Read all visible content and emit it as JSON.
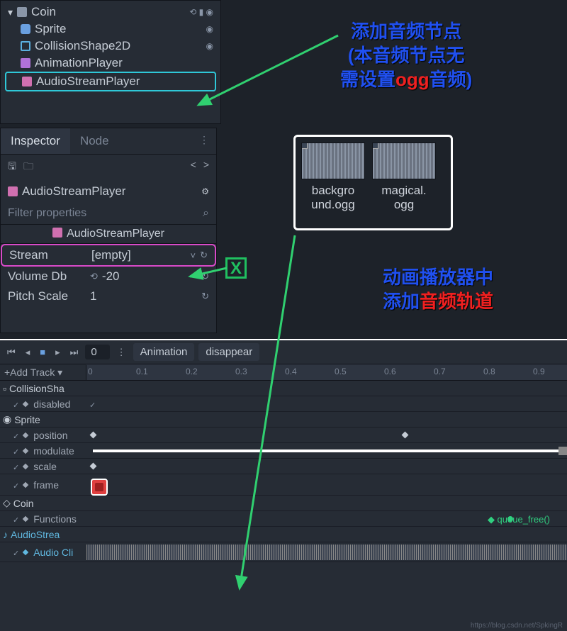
{
  "scene": {
    "root": "Coin",
    "children": [
      "Sprite",
      "CollisionShape2D",
      "AnimationPlayer",
      "AudioStreamPlayer"
    ]
  },
  "inspector": {
    "tabs": [
      "Inspector",
      "Node"
    ],
    "object": "AudioStreamPlayer",
    "filter": "Filter properties",
    "class_header": "AudioStreamPlayer",
    "props": {
      "stream_label": "Stream",
      "stream_value": "[empty]",
      "volume_label": "Volume Db",
      "volume_value": "-20",
      "pitch_label": "Pitch Scale",
      "pitch_value": "1"
    }
  },
  "resources": {
    "items": [
      {
        "name_line1": "backgro",
        "name_line2": "und.ogg"
      },
      {
        "name_line1": "magical.",
        "name_line2": "ogg"
      }
    ]
  },
  "annotations": {
    "a1_line1": "添加音频节点",
    "a1_line2_a": "(本音频节点无",
    "a1_line3_a": "需设置",
    "a1_line3_b": "ogg",
    "a1_line3_c": "音频)",
    "a2_line1": "动画播放器中",
    "a2_line2_a": "添加",
    "a2_line2_b": "音频轨道",
    "a3": "音频轨道",
    "xbox": "X"
  },
  "animation": {
    "toolbar": {
      "frame": "0",
      "label": "Animation",
      "name": "disappear"
    },
    "add_track": "+Add Track",
    "ticks": [
      "0",
      "0.1",
      "0.2",
      "0.3",
      "0.4",
      "0.5",
      "0.6",
      "0.7",
      "0.8",
      "0.9"
    ],
    "tracks": {
      "collision": "CollisionSha",
      "disabled": "disabled",
      "sprite": "Sprite",
      "position": "position",
      "modulate": "modulate",
      "scale": "scale",
      "frame": "frame",
      "coin": "Coin",
      "functions": "Functions",
      "queue_free": "queue_free()",
      "audiostrea": "AudioStrea",
      "audioclip": "Audio Cli"
    }
  },
  "watermark": "https://blog.csdn.net/SpkingR"
}
